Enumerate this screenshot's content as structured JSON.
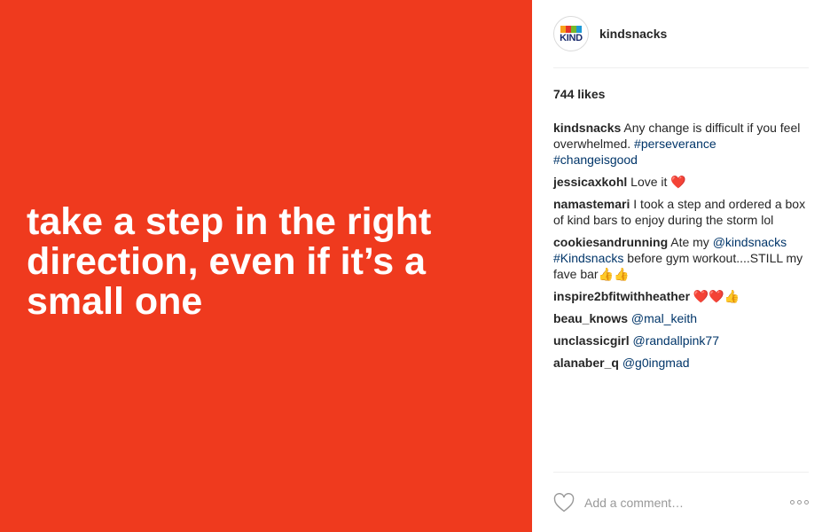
{
  "post": {
    "media_lines": [
      "take a step in the right",
      "direction, even if it’s a",
      "small one"
    ],
    "media_color": "#ef3a1e"
  },
  "header": {
    "avatar_text": "KIND",
    "avatar_colors": [
      "#f7a11a",
      "#e6332a",
      "#76b82a",
      "#1d9ad6",
      "#1a2b6d"
    ],
    "username": "kindsnacks"
  },
  "likes": "744 likes",
  "comments": [
    {
      "user": "kindsnacks",
      "text": " Any change is difficult if you feel overwhelmed. ",
      "link": "#perseverance",
      "link2": "#changeisgood"
    },
    {
      "user": "jessicaxkohl",
      "text": " Love it ",
      "emoji": "❤️"
    },
    {
      "user": "namastemari",
      "text": " I took a step and ordered a box of kind bars to enjoy during the storm lol"
    },
    {
      "user": "cookiesandrunning",
      "text1": " Ate my ",
      "link": "@kindsnacks",
      "link2": "#Kindsnacks",
      "text2": " before gym workout....STILL my fave bar",
      "emoji": "👍👍"
    },
    {
      "user": "inspire2bfitwithheather",
      "emoji": " ❤️❤️👍"
    },
    {
      "user": "beau_knows",
      "link": "@mal_keith"
    },
    {
      "user": "unclassicgirl",
      "link": "@randallpink77"
    },
    {
      "user": "alanaber_q",
      "link": "@g0ingmad"
    }
  ],
  "footer": {
    "placeholder": "Add a comment…",
    "like_icon": "heart-outline-icon",
    "more_icon": "more-options-icon"
  }
}
